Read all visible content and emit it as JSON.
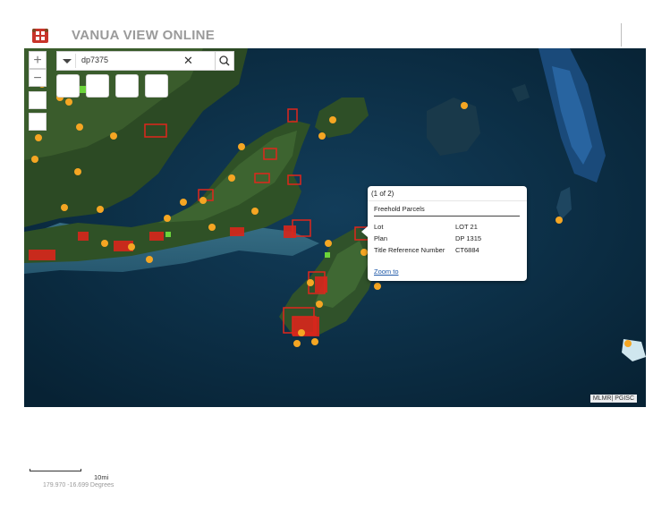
{
  "header": {
    "title": "VANUA VIEW ONLINE"
  },
  "search": {
    "value": "dp7375",
    "clear_icon": "close-icon",
    "go_icon": "search-icon"
  },
  "zoom": {
    "in_label": "+",
    "out_label": "−"
  },
  "popup": {
    "header": "(1 of 2)",
    "layer": "Freehold Parcels",
    "attributes": [
      {
        "name": "Lot",
        "value": "LOT 21"
      },
      {
        "name": "Plan",
        "value": "DP 1315"
      },
      {
        "name": "Title Reference Number",
        "value": "CT6884"
      }
    ],
    "zoom_link": "Zoom to"
  },
  "attribution": "MLMR| PGISC",
  "scale": {
    "label": "10mi"
  },
  "coordinates": "179.970 -16.699 Degrees",
  "colors": {
    "title": "#9a9a9a",
    "parcel_outline": "#e0261c",
    "point_marker": "#f5a623",
    "ocean": "#0b2f47",
    "link": "#1f59a8"
  }
}
